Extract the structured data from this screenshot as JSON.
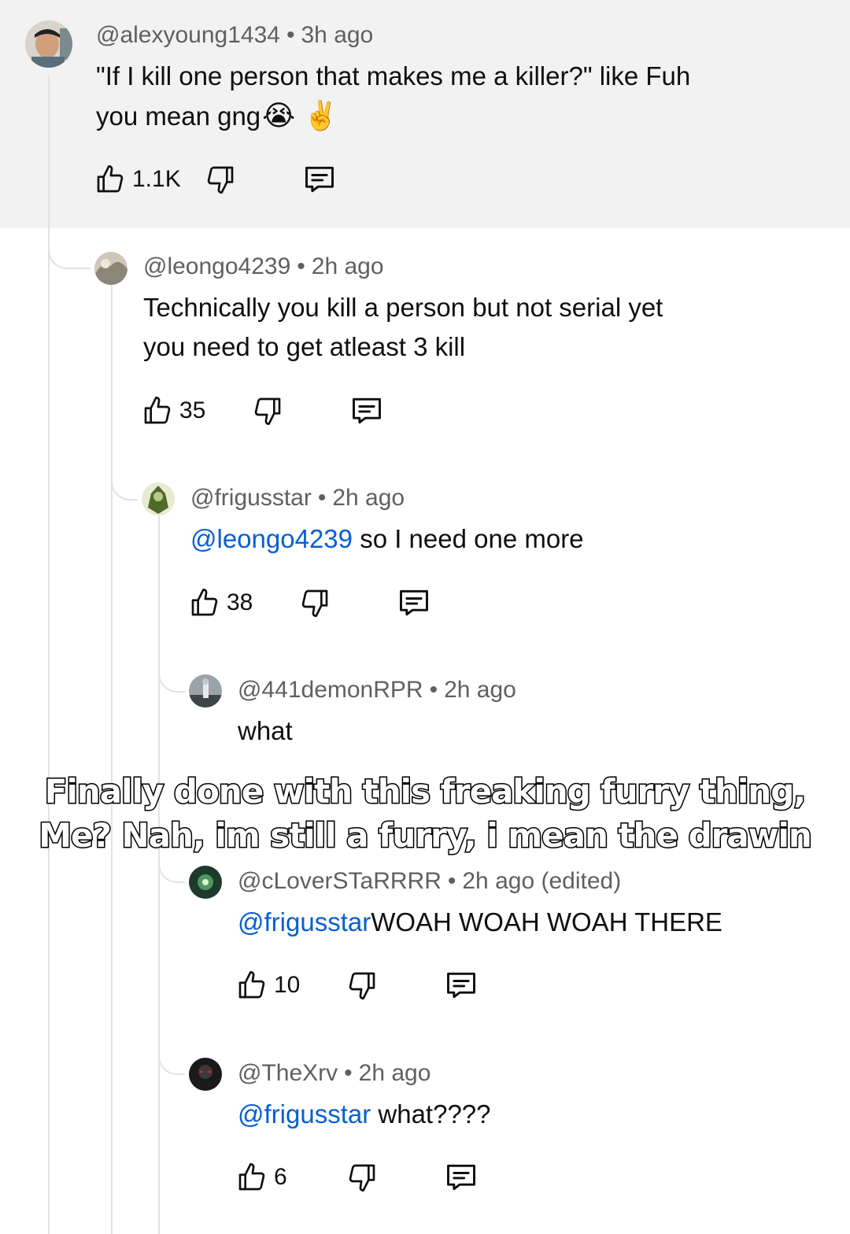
{
  "comments": [
    {
      "handle": "@alexyoung1434",
      "time": "3h ago",
      "text_line1": "\"If I kill one person that makes me a killer?\" like Fuh",
      "text_line2": "you mean gng",
      "emoji1": "😭",
      "emoji2": "✌️",
      "likes": "1.1K"
    },
    {
      "handle": "@leongo4239",
      "time": "2h ago",
      "text_line1": "Technically you kill a person but not serial yet",
      "text_line2": "you need to get atleast 3 kill",
      "likes": "35"
    },
    {
      "handle": "@frigusstar",
      "time": "2h ago",
      "mention": "@leongo4239",
      "text": "so I need one more",
      "likes": "38"
    },
    {
      "handle": "@441demonRPR",
      "time": "2h ago",
      "text": "what"
    },
    {
      "handle": "@cLoverSTaRRRR",
      "time": "2h ago (edited)",
      "mention": "@frigusstar",
      "text": "WOAH WOAH WOAH THERE",
      "likes": "10"
    },
    {
      "handle": "@TheXrv",
      "time": "2h ago",
      "mention": "@frigusstar",
      "text": "what????",
      "likes": "6"
    }
  ],
  "overlay": {
    "line1": "Finally done with this freaking furry thing,",
    "line2": "Me? Nah, im still a furry, i mean the drawin"
  },
  "icons": {
    "like": "thumbs-up-icon",
    "dislike": "thumbs-down-icon",
    "reply": "reply-comment-icon"
  },
  "colors": {
    "mention": "#065fd4",
    "meta": "#606060",
    "highlight_band": "#f2f2f2"
  }
}
